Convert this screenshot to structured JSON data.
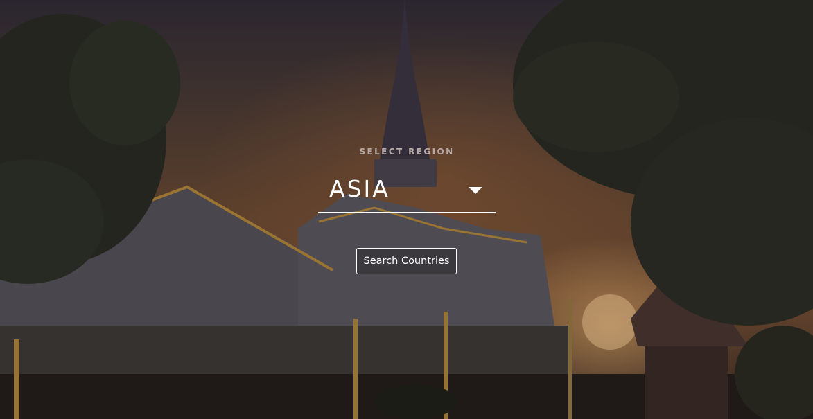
{
  "region_selector": {
    "label": "SELECT REGION",
    "selected_value": "ASIA",
    "caret_icon": "caret-down-icon"
  },
  "actions": {
    "search_label": "Search Countries"
  },
  "background": {
    "subject": "temple-at-sunset-photo",
    "accent_color": "#ffffff"
  }
}
